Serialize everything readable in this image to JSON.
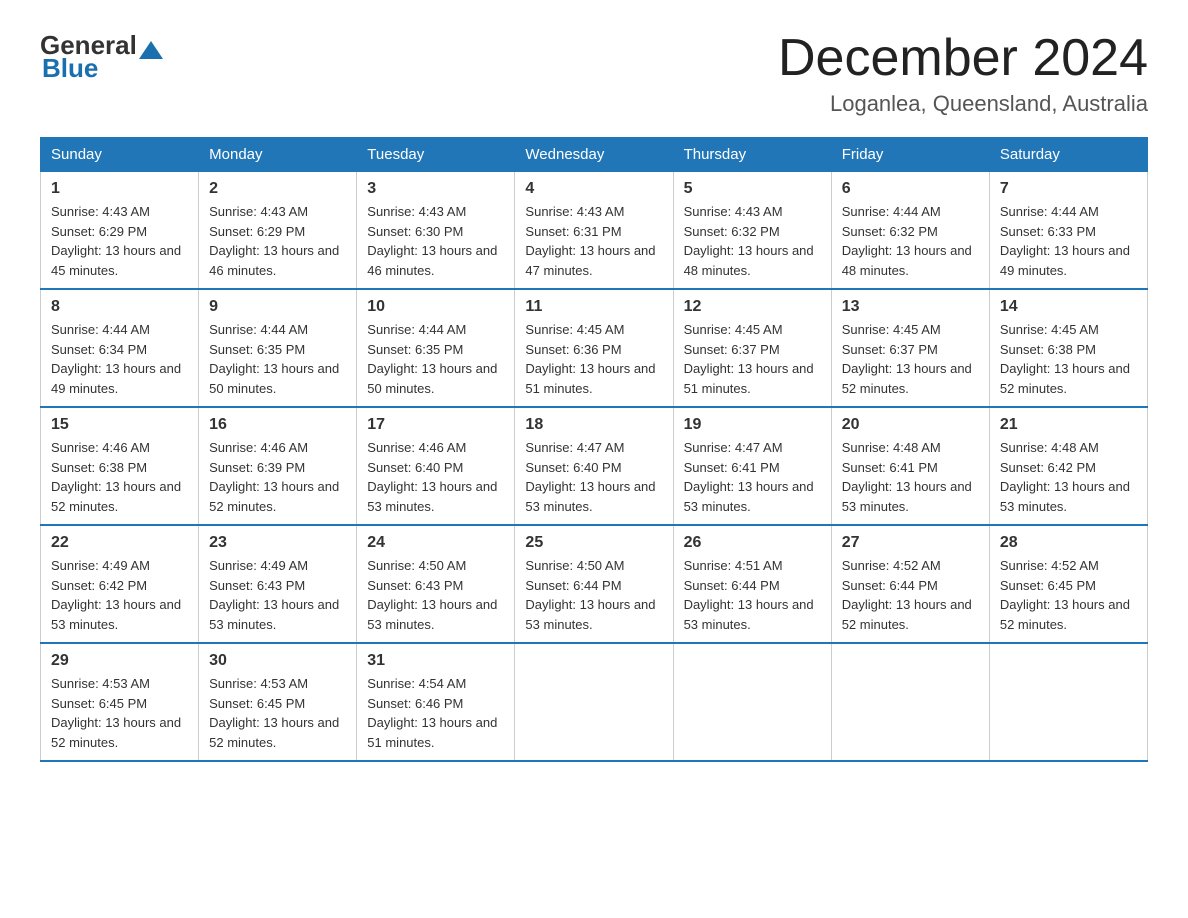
{
  "header": {
    "logo_general": "General",
    "logo_blue": "Blue",
    "month_title": "December 2024",
    "location": "Loganlea, Queensland, Australia"
  },
  "days_of_week": [
    "Sunday",
    "Monday",
    "Tuesday",
    "Wednesday",
    "Thursday",
    "Friday",
    "Saturday"
  ],
  "weeks": [
    [
      {
        "day": "1",
        "sunrise": "4:43 AM",
        "sunset": "6:29 PM",
        "daylight": "13 hours and 45 minutes."
      },
      {
        "day": "2",
        "sunrise": "4:43 AM",
        "sunset": "6:29 PM",
        "daylight": "13 hours and 46 minutes."
      },
      {
        "day": "3",
        "sunrise": "4:43 AM",
        "sunset": "6:30 PM",
        "daylight": "13 hours and 46 minutes."
      },
      {
        "day": "4",
        "sunrise": "4:43 AM",
        "sunset": "6:31 PM",
        "daylight": "13 hours and 47 minutes."
      },
      {
        "day": "5",
        "sunrise": "4:43 AM",
        "sunset": "6:32 PM",
        "daylight": "13 hours and 48 minutes."
      },
      {
        "day": "6",
        "sunrise": "4:44 AM",
        "sunset": "6:32 PM",
        "daylight": "13 hours and 48 minutes."
      },
      {
        "day": "7",
        "sunrise": "4:44 AM",
        "sunset": "6:33 PM",
        "daylight": "13 hours and 49 minutes."
      }
    ],
    [
      {
        "day": "8",
        "sunrise": "4:44 AM",
        "sunset": "6:34 PM",
        "daylight": "13 hours and 49 minutes."
      },
      {
        "day": "9",
        "sunrise": "4:44 AM",
        "sunset": "6:35 PM",
        "daylight": "13 hours and 50 minutes."
      },
      {
        "day": "10",
        "sunrise": "4:44 AM",
        "sunset": "6:35 PM",
        "daylight": "13 hours and 50 minutes."
      },
      {
        "day": "11",
        "sunrise": "4:45 AM",
        "sunset": "6:36 PM",
        "daylight": "13 hours and 51 minutes."
      },
      {
        "day": "12",
        "sunrise": "4:45 AM",
        "sunset": "6:37 PM",
        "daylight": "13 hours and 51 minutes."
      },
      {
        "day": "13",
        "sunrise": "4:45 AM",
        "sunset": "6:37 PM",
        "daylight": "13 hours and 52 minutes."
      },
      {
        "day": "14",
        "sunrise": "4:45 AM",
        "sunset": "6:38 PM",
        "daylight": "13 hours and 52 minutes."
      }
    ],
    [
      {
        "day": "15",
        "sunrise": "4:46 AM",
        "sunset": "6:38 PM",
        "daylight": "13 hours and 52 minutes."
      },
      {
        "day": "16",
        "sunrise": "4:46 AM",
        "sunset": "6:39 PM",
        "daylight": "13 hours and 52 minutes."
      },
      {
        "day": "17",
        "sunrise": "4:46 AM",
        "sunset": "6:40 PM",
        "daylight": "13 hours and 53 minutes."
      },
      {
        "day": "18",
        "sunrise": "4:47 AM",
        "sunset": "6:40 PM",
        "daylight": "13 hours and 53 minutes."
      },
      {
        "day": "19",
        "sunrise": "4:47 AM",
        "sunset": "6:41 PM",
        "daylight": "13 hours and 53 minutes."
      },
      {
        "day": "20",
        "sunrise": "4:48 AM",
        "sunset": "6:41 PM",
        "daylight": "13 hours and 53 minutes."
      },
      {
        "day": "21",
        "sunrise": "4:48 AM",
        "sunset": "6:42 PM",
        "daylight": "13 hours and 53 minutes."
      }
    ],
    [
      {
        "day": "22",
        "sunrise": "4:49 AM",
        "sunset": "6:42 PM",
        "daylight": "13 hours and 53 minutes."
      },
      {
        "day": "23",
        "sunrise": "4:49 AM",
        "sunset": "6:43 PM",
        "daylight": "13 hours and 53 minutes."
      },
      {
        "day": "24",
        "sunrise": "4:50 AM",
        "sunset": "6:43 PM",
        "daylight": "13 hours and 53 minutes."
      },
      {
        "day": "25",
        "sunrise": "4:50 AM",
        "sunset": "6:44 PM",
        "daylight": "13 hours and 53 minutes."
      },
      {
        "day": "26",
        "sunrise": "4:51 AM",
        "sunset": "6:44 PM",
        "daylight": "13 hours and 53 minutes."
      },
      {
        "day": "27",
        "sunrise": "4:52 AM",
        "sunset": "6:44 PM",
        "daylight": "13 hours and 52 minutes."
      },
      {
        "day": "28",
        "sunrise": "4:52 AM",
        "sunset": "6:45 PM",
        "daylight": "13 hours and 52 minutes."
      }
    ],
    [
      {
        "day": "29",
        "sunrise": "4:53 AM",
        "sunset": "6:45 PM",
        "daylight": "13 hours and 52 minutes."
      },
      {
        "day": "30",
        "sunrise": "4:53 AM",
        "sunset": "6:45 PM",
        "daylight": "13 hours and 52 minutes."
      },
      {
        "day": "31",
        "sunrise": "4:54 AM",
        "sunset": "6:46 PM",
        "daylight": "13 hours and 51 minutes."
      },
      null,
      null,
      null,
      null
    ]
  ]
}
